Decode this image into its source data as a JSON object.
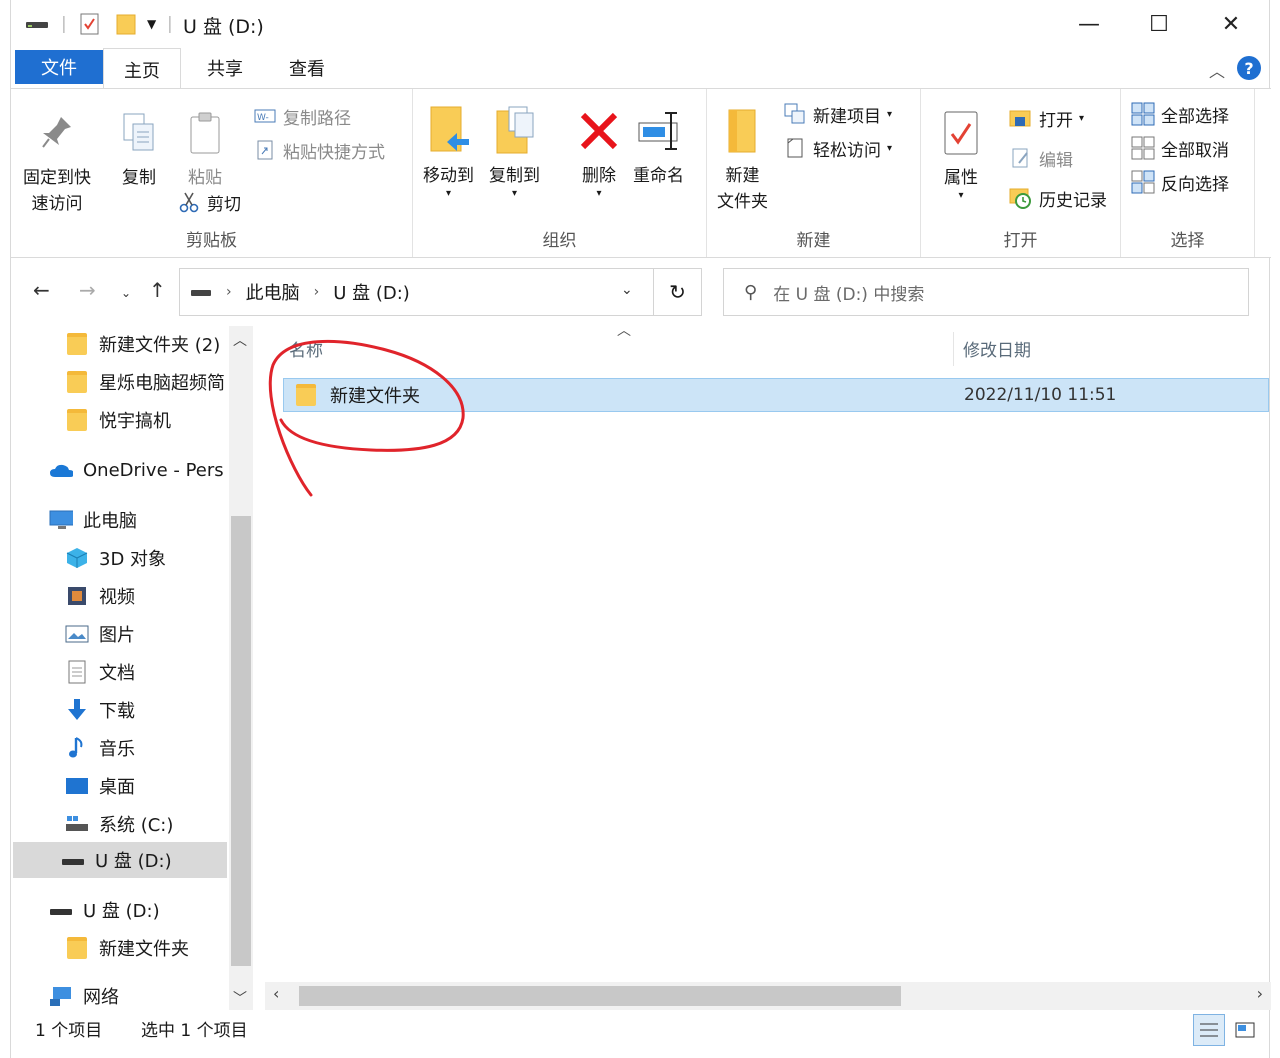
{
  "window": {
    "title": "U 盘 (D:)",
    "minimize": "—",
    "maximize": "☐",
    "close": "✕"
  },
  "ribbon_tabs": [
    "文件",
    "主页",
    "共享",
    "查看"
  ],
  "ribbon": {
    "clipboard": {
      "label": "剪贴板",
      "pin_label_1": "固定到快",
      "pin_label_2": "速访问",
      "copy": "复制",
      "paste": "粘贴",
      "copy_path": "复制路径",
      "paste_shortcut": "粘贴快捷方式",
      "cut": "剪切"
    },
    "organize": {
      "label": "组织",
      "move_to": "移动到",
      "copy_to": "复制到",
      "delete": "删除",
      "rename": "重命名"
    },
    "new": {
      "label": "新建",
      "new_folder_1": "新建",
      "new_folder_2": "文件夹",
      "new_item": "新建项目",
      "easy_access": "轻松访问"
    },
    "open": {
      "label": "打开",
      "properties": "属性",
      "open": "打开",
      "edit": "编辑",
      "history": "历史记录"
    },
    "select": {
      "label": "选择",
      "select_all": "全部选择",
      "select_none": "全部取消",
      "invert": "反向选择"
    }
  },
  "address": {
    "crumbs": [
      "此电脑",
      "U 盘 (D:)"
    ],
    "search_placeholder": "在 U 盘 (D:) 中搜索"
  },
  "nav_pane": {
    "items": [
      {
        "label": "新建文件夹 (2)",
        "icon": "folder-icon"
      },
      {
        "label": "星烁电脑超频简",
        "icon": "folder-icon"
      },
      {
        "label": "悦宇搞机",
        "icon": "folder-icon"
      },
      {
        "label": "OneDrive - Pers",
        "icon": "cloud-icon"
      },
      {
        "label": "此电脑",
        "icon": "computer-icon"
      },
      {
        "label": "3D 对象",
        "icon": "cube-icon"
      },
      {
        "label": "视频",
        "icon": "video-icon"
      },
      {
        "label": "图片",
        "icon": "pictures-icon"
      },
      {
        "label": "文档",
        "icon": "document-icon"
      },
      {
        "label": "下载",
        "icon": "download-icon"
      },
      {
        "label": "音乐",
        "icon": "music-icon"
      },
      {
        "label": "桌面",
        "icon": "desktop-icon"
      },
      {
        "label": "系统 (C:)",
        "icon": "drive-c-icon"
      },
      {
        "label": "U 盘 (D:)",
        "icon": "usb-drive-icon",
        "selected": true
      },
      {
        "label": "U 盘 (D:)",
        "icon": "usb-drive-icon"
      },
      {
        "label": "新建文件夹",
        "icon": "folder-icon"
      },
      {
        "label": "网络",
        "icon": "network-icon"
      }
    ]
  },
  "content": {
    "columns": [
      "名称",
      "修改日期"
    ],
    "files": [
      {
        "name": "新建文件夹",
        "modified": "2022/11/10 11:51",
        "selected": true
      }
    ]
  },
  "status": {
    "item_count": "1 个项目",
    "selected": "选中 1 个项目"
  },
  "colors": {
    "accent": "#1f6fd1",
    "selection": "#cce4f7",
    "folder": "#f9cc56",
    "annotation": "#e0242b"
  }
}
